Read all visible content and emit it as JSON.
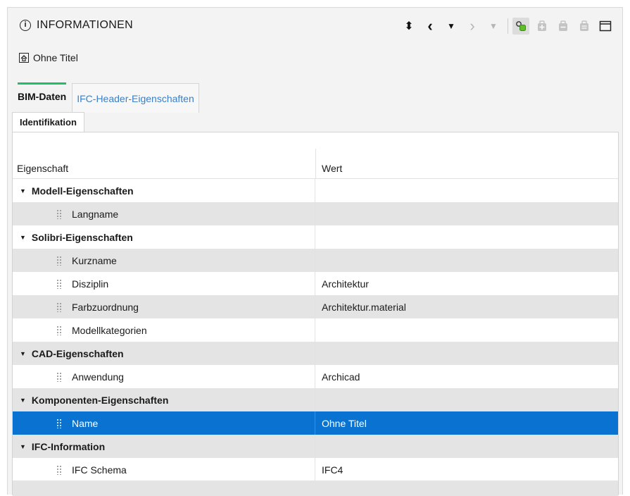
{
  "header": {
    "title": "INFORMATIONEN",
    "info_icon": "i"
  },
  "toolbar": {
    "icons": [
      "sort-updown-icon",
      "prev-icon",
      "dropdown-icon",
      "next-icon",
      "dropdown-dim-icon",
      "model-link-icon",
      "bag-icon",
      "bag-icon",
      "bag-icon",
      "window-icon"
    ],
    "glyphs": {
      "sort": "⬍",
      "prev": "‹",
      "drop": "▼",
      "next": "›",
      "drop_dim": "▼",
      "model": "⬡",
      "bag": "⊕",
      "window": "▭"
    }
  },
  "model": {
    "label": "Ohne Titel"
  },
  "tabs": [
    {
      "label": "BIM-Daten",
      "active": true
    },
    {
      "label": "IFC-Header-Eigenschaften",
      "active": false
    }
  ],
  "subtab": {
    "label": "Identifikation"
  },
  "table": {
    "col_property": "Eigenschaft",
    "col_value": "Wert",
    "rows": [
      {
        "type": "group",
        "label": "Modell-Eigenschaften",
        "value": ""
      },
      {
        "type": "child",
        "label": "Langname",
        "value": ""
      },
      {
        "type": "group",
        "label": "Solibri-Eigenschaften",
        "value": ""
      },
      {
        "type": "child",
        "label": "Kurzname",
        "value": ""
      },
      {
        "type": "child",
        "label": "Disziplin",
        "value": "Architektur"
      },
      {
        "type": "child",
        "label": "Farbzuordnung",
        "value": "Architektur.material"
      },
      {
        "type": "child",
        "label": "Modellkategorien",
        "value": ""
      },
      {
        "type": "group",
        "label": "CAD-Eigenschaften",
        "value": ""
      },
      {
        "type": "child",
        "label": "Anwendung",
        "value": "Archicad"
      },
      {
        "type": "group",
        "label": "Komponenten-Eigenschaften",
        "value": ""
      },
      {
        "type": "child",
        "label": "Name",
        "value": "Ohne Titel",
        "selected": true
      },
      {
        "type": "group",
        "label": "IFC-Information",
        "value": ""
      },
      {
        "type": "child",
        "label": "IFC Schema",
        "value": "IFC4"
      }
    ]
  },
  "colors": {
    "accent_tab": "#1fbf6a",
    "selection": "#0a73d1",
    "link_tab": "#3a7fc8"
  }
}
